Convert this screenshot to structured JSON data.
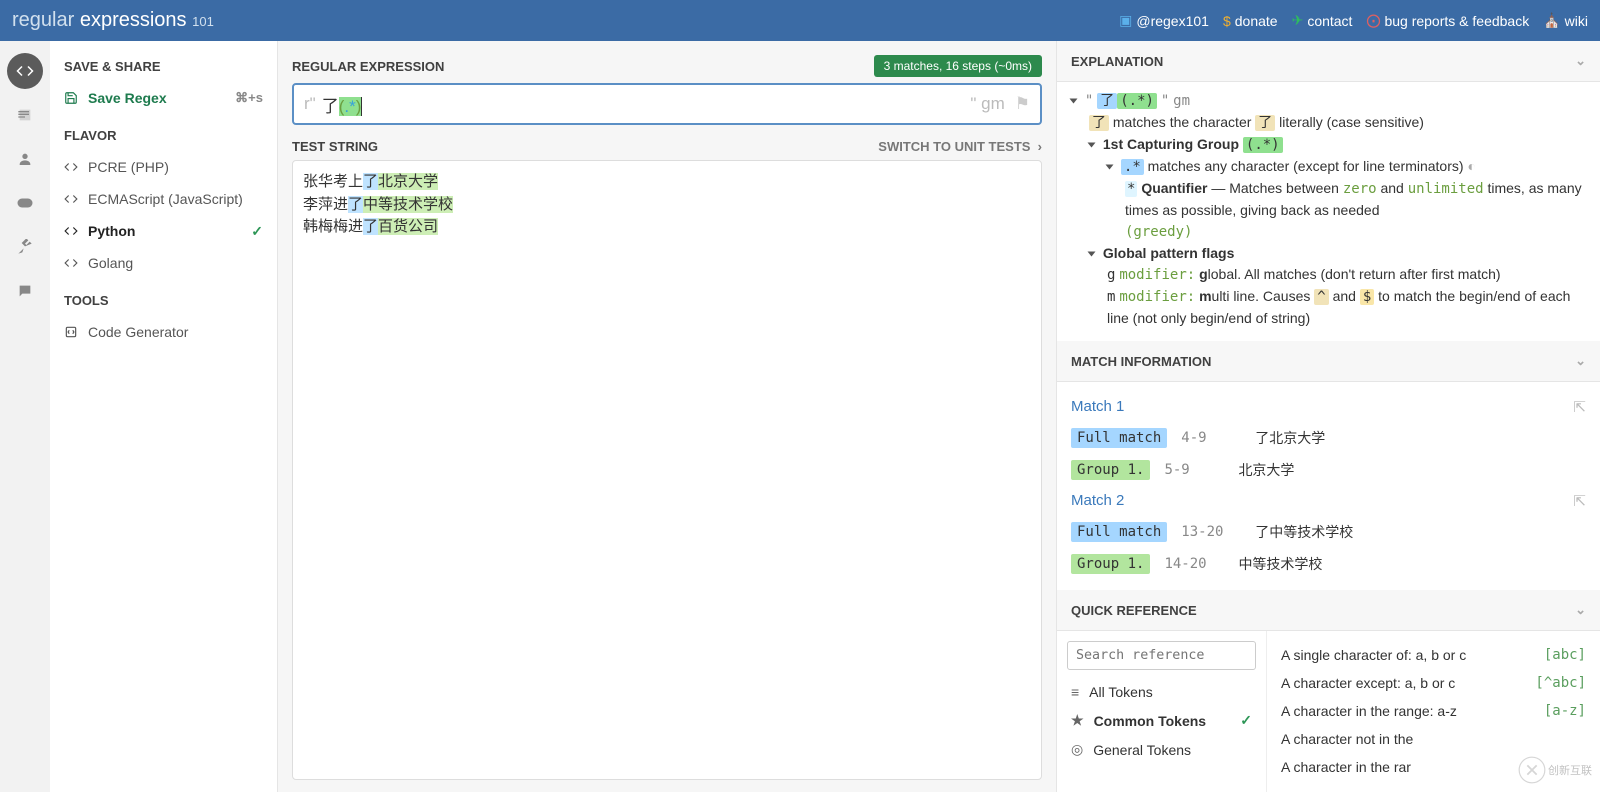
{
  "header": {
    "logo_text1": "regular",
    "logo_text2": "expressions",
    "logo_sub": "101",
    "links": [
      {
        "icon": "twitter",
        "label": "@regex101"
      },
      {
        "icon": "donate",
        "label": "donate"
      },
      {
        "icon": "contact",
        "label": "contact"
      },
      {
        "icon": "bug",
        "label": "bug reports & feedback"
      },
      {
        "icon": "wiki",
        "label": "wiki"
      }
    ]
  },
  "left": {
    "save_share": "SAVE & SHARE",
    "save_regex": "Save Regex",
    "save_shortcut": "⌘+s",
    "flavor": "FLAVOR",
    "flavors": [
      {
        "label": "PCRE (PHP)"
      },
      {
        "label": "ECMAScript (JavaScript)"
      },
      {
        "label": "Python",
        "selected": true
      },
      {
        "label": "Golang"
      }
    ],
    "tools": "TOOLS",
    "code_gen": "Code Generator"
  },
  "center": {
    "regex_label": "REGULAR EXPRESSION",
    "match_badge": "3 matches, 16 steps (~0ms)",
    "delim_left": "r\"",
    "regex_plain": "了",
    "regex_group": "(.*)",
    "delim_right": "\"",
    "flags": "gm",
    "test_label": "TEST STRING",
    "switch": "SWITCH TO UNIT TESTS",
    "lines": [
      {
        "pre": "张华考上",
        "le": "了",
        "cap": "北京大学"
      },
      {
        "pre": "李萍进",
        "le": "了",
        "cap": "中等技术学校"
      },
      {
        "pre": "韩梅梅进",
        "le": "了",
        "cap": "百货公司"
      }
    ]
  },
  "explanation": {
    "title": "EXPLANATION",
    "top_quote": "\"",
    "top_le": "了",
    "top_grp": "(.*)",
    "top_flags": "gm",
    "le_char": "了",
    "le_desc1": " matches the character ",
    "le_desc2": " literally (case sensitive)",
    "cap_title": "1st Capturing Group ",
    "cap_tok": "(.*)",
    "dot_tok": ".*",
    "dot_desc": " matches any character (except for line terminators)",
    "star_tok": "*",
    "star_lbl": " Quantifier",
    "star_desc1": " — Matches between ",
    "zero": "zero",
    "and": " and ",
    "unlimited": "unlimited",
    "star_desc2": " times, as many times as possible, giving back as needed ",
    "greedy": "(greedy)",
    "flags_title": "Global pattern flags",
    "g_tok": "g",
    "g_lbl": "modifier:",
    "g_desc": "lobal. All matches (don't return after first match)",
    "m_tok": "m",
    "m_lbl": "modifier:",
    "m_desc1": "ulti line. Causes ",
    "caret": "^",
    "m_and": " and ",
    "dollar": "$",
    "m_desc2": " to match the begin/end of each line (not only begin/end of string)"
  },
  "matchinfo": {
    "title": "MATCH INFORMATION",
    "matches": [
      {
        "name": "Match 1",
        "rows": [
          {
            "tag": "Full match",
            "cls": "full",
            "range": "4-9",
            "text": "了北京大学"
          },
          {
            "tag": "Group 1.",
            "cls": "grp",
            "range": "5-9",
            "text": "北京大学"
          }
        ]
      },
      {
        "name": "Match 2",
        "rows": [
          {
            "tag": "Full match",
            "cls": "full",
            "range": "13-20",
            "text": "了中等技术学校"
          },
          {
            "tag": "Group 1.",
            "cls": "grp",
            "range": "14-20",
            "text": "中等技术学校"
          }
        ]
      }
    ]
  },
  "quickref": {
    "title": "QUICK REFERENCE",
    "search_placeholder": "Search reference",
    "left": [
      {
        "icon": "all",
        "label": "All Tokens"
      },
      {
        "icon": "star",
        "label": "Common Tokens",
        "selected": true
      },
      {
        "icon": "general",
        "label": "General Tokens"
      }
    ],
    "right": [
      {
        "desc": "A single character of: a, b or c",
        "tok": "[abc]"
      },
      {
        "desc": "A character except: a, b or c",
        "tok": "[^abc]"
      },
      {
        "desc": "A character in the range: a-z",
        "tok": "[a-z]"
      },
      {
        "desc": "A character not in the",
        "tok": ""
      },
      {
        "desc": "A character in the rar",
        "tok": ""
      }
    ]
  }
}
